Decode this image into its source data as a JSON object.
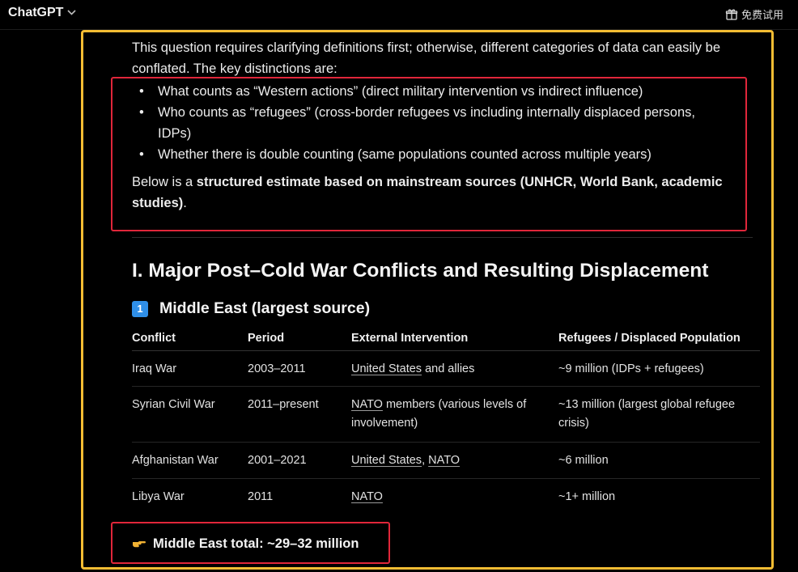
{
  "header": {
    "app_title": "ChatGPT",
    "trial_label": "免费试用"
  },
  "message": {
    "intro": "This question requires clarifying definitions first; otherwise, different categories of data can easily be conflated. The key distinctions are:",
    "bullets": [
      "What counts as “Western actions” (direct military intervention vs indirect influence)",
      "Who counts as “refugees” (cross-border refugees vs including internally displaced persons, IDPs)",
      "Whether there is double counting (same populations counted across multiple years)"
    ],
    "below_prefix": "Below is a ",
    "below_bold": "structured estimate based on mainstream sources (UNHCR, World Bank, academic studies)",
    "below_suffix": ".",
    "section_heading": "I. Major Post–Cold War Conflicts and Resulting Displacement",
    "subsection_number": "1",
    "subsection_heading": "Middle East (largest source)",
    "table": {
      "headers": [
        "Conflict",
        "Period",
        "External Intervention",
        "Refugees / Displaced Population"
      ],
      "rows": [
        {
          "conflict": "Iraq War",
          "period": "2003–2011",
          "link1": "United States",
          "rest": " and allies",
          "refugees": "~9 million (IDPs + refugees)"
        },
        {
          "conflict": "Syrian Civil War",
          "period": "2011–present",
          "link1": "NATO",
          "rest": " members (various levels of involvement)",
          "refugees": "~13 million (largest global refugee crisis)"
        },
        {
          "conflict": "Afghanistan War",
          "period": "2001–2021",
          "link1": "United States",
          "sep": ", ",
          "link2": "NATO",
          "refugees": "~6 million"
        },
        {
          "conflict": "Libya War",
          "period": "2011",
          "link1": "NATO",
          "refugees": "~1+ million"
        }
      ]
    },
    "total": "Middle East total: ~29–32 million"
  },
  "colors": {
    "background": "#000000",
    "highlight_frame": "#f6bd33",
    "annotation_box": "#e0263a",
    "keycap": "#2f8fe8"
  },
  "icons": {
    "dropdown": "chevron-down-icon",
    "gift": "gift-icon",
    "pointing": "pointing-hand-icon"
  }
}
